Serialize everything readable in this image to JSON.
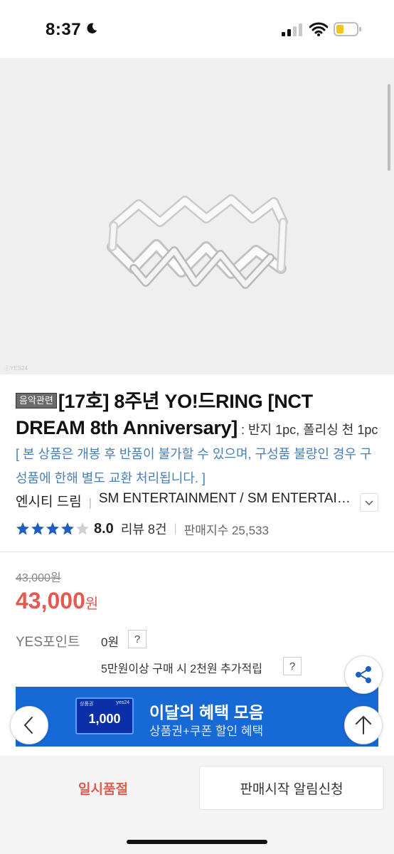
{
  "status_bar": {
    "time": "8:37"
  },
  "product_image": {
    "alt": "silver ring",
    "watermark": "ⓒYES24"
  },
  "product": {
    "category_badge": "음악관련",
    "title": "[17호] 8주년 YO!드RING [NCT DREAM 8th Anniversary]",
    "subtitle": " : 반지 1pc, 폴리싱 천 1pc ",
    "notice": "[ 본 상품은 개봉 후 반품이 불가할 수 있으며, 구성품 불량인 경우 구성품에 한해 별도 교환 처리됩니다. ]",
    "artist": "엔시티 드림",
    "artist_separator": "|",
    "label": "SM ENTERTAINMENT / SM ENTERTAINMENT"
  },
  "rating": {
    "stars_filled": 4,
    "stars_total": 5,
    "score": "8.0",
    "review_label": "리뷰 8건",
    "separator": "|",
    "sales_label": "판매지수 25,533"
  },
  "price": {
    "original": "43,000원",
    "sale_amount": "43,000",
    "sale_unit": "원"
  },
  "points": {
    "label": "YES포인트",
    "value": "0원",
    "help": "?",
    "bonus_text": "5만원이상 구매 시 2천원 추가적립",
    "bonus_help": "?"
  },
  "banner": {
    "voucher_tag": "상품권",
    "voucher_brand": "yes24",
    "voucher_amount": "1,000",
    "title": "이달의 혜택 모음",
    "subtitle": "상품권+쿠폰 할인 혜택"
  },
  "actions": {
    "soldout": "일시품절",
    "notify": "판매시작 알림신청"
  },
  "colors": {
    "sale_red": "#e55a50",
    "notice_blue": "#4a7fb5",
    "banner_blue": "#1769d6",
    "star_blue": "#1f5fbf"
  },
  "icons": [
    "moon-icon",
    "signal-icon",
    "wifi-icon",
    "battery-icon",
    "chevron-down-icon",
    "star-icon",
    "share-icon",
    "chevron-left-icon",
    "arrow-up-icon"
  ]
}
